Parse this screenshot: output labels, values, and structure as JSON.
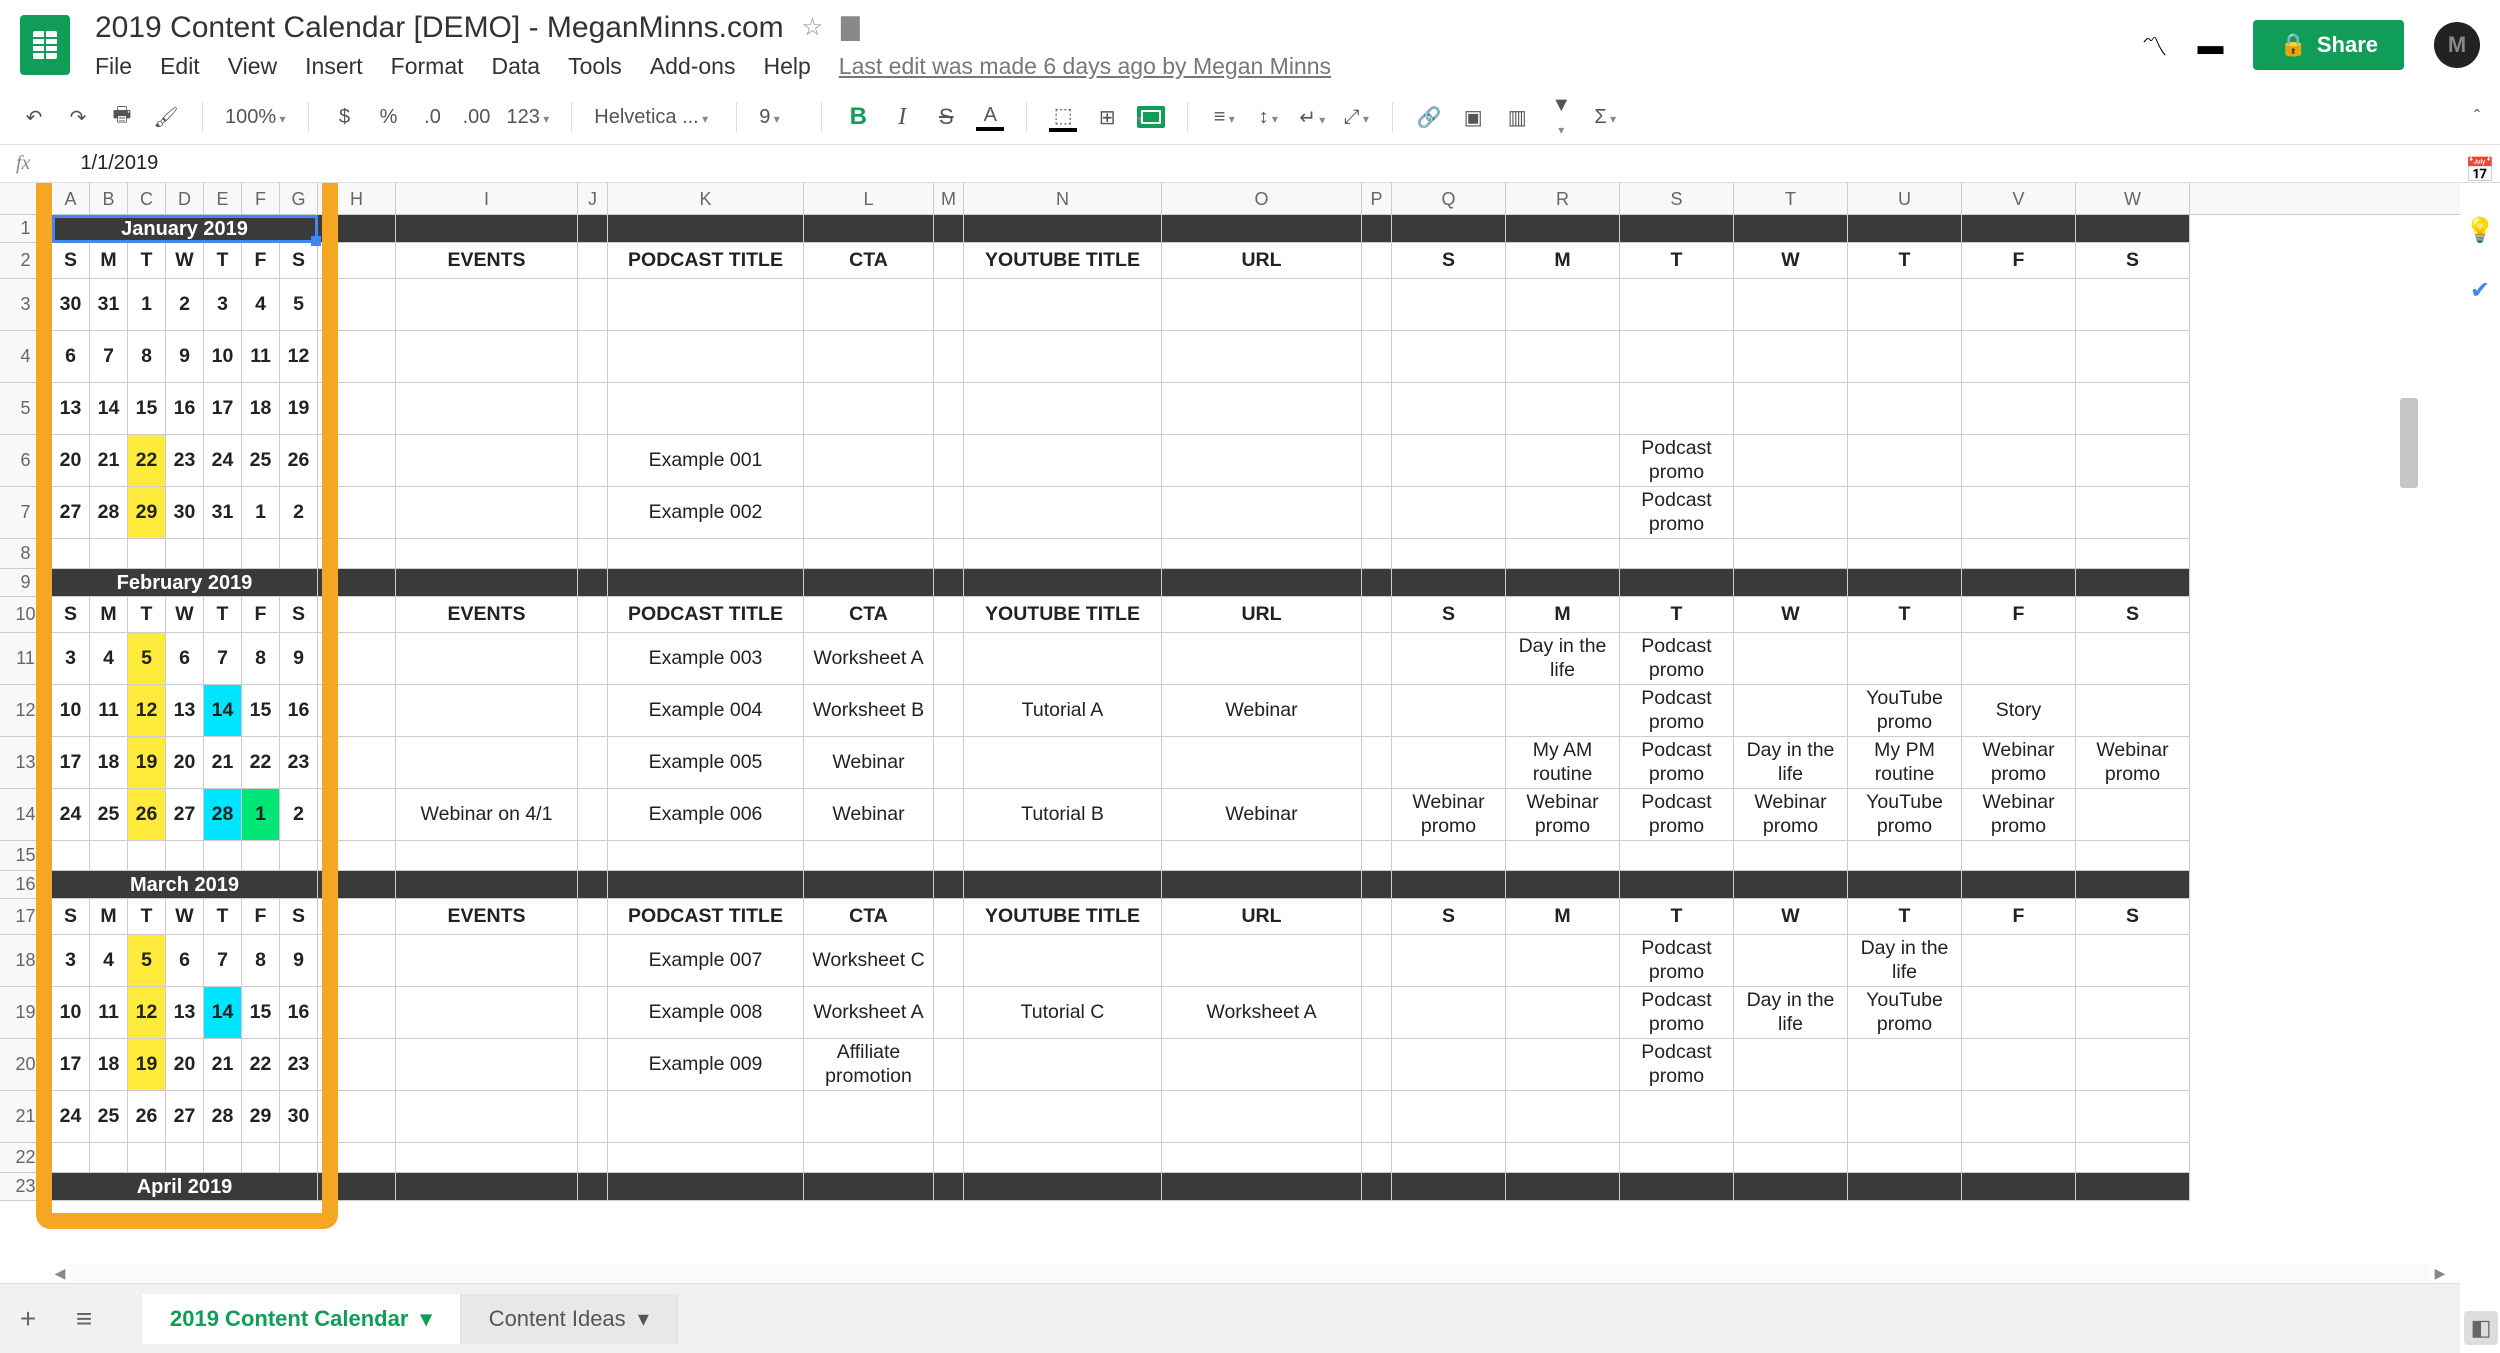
{
  "doc": {
    "title": "2019 Content Calendar [DEMO] - MeganMinns.com"
  },
  "menu": {
    "file": "File",
    "edit": "Edit",
    "view": "View",
    "insert": "Insert",
    "format": "Format",
    "data": "Data",
    "tools": "Tools",
    "addons": "Add-ons",
    "help": "Help",
    "lastEdit": "Last edit was made 6 days ago by Megan Minns"
  },
  "toolbar": {
    "zoom": "100%",
    "font": "Helvetica ...",
    "size": "9",
    "decimals": ".0",
    "decimals2": ".00",
    "format123": "123"
  },
  "share": "Share",
  "avatar": "M",
  "fx": {
    "value": "1/1/2019"
  },
  "tabs": {
    "active": "2019 Content Calendar",
    "second": "Content Ideas"
  },
  "columns": [
    "A",
    "B",
    "C",
    "D",
    "E",
    "F",
    "G",
    "H",
    "I",
    "J",
    "K",
    "L",
    "M",
    "N",
    "O",
    "P",
    "Q",
    "R",
    "S",
    "T",
    "U",
    "V",
    "W"
  ],
  "colWidths": {
    "cal": 38,
    "H": 78,
    "I": 182,
    "J": 30,
    "K": 196,
    "L": 130,
    "M": 30,
    "N": 198,
    "O": 200,
    "P": 30,
    "QW": 114
  },
  "rowNums": [
    1,
    2,
    3,
    4,
    5,
    6,
    7,
    8,
    9,
    10,
    11,
    12,
    13,
    14,
    15,
    16,
    17,
    18,
    19,
    20,
    21,
    22,
    23
  ],
  "months": {
    "jan": "January 2019",
    "feb": "February 2019",
    "mar": "March 2019",
    "apr": "April 2019"
  },
  "dayHdr": [
    "S",
    "M",
    "T",
    "W",
    "T",
    "F",
    "S"
  ],
  "contentHdr": {
    "events": "EVENTS",
    "podcast": "PODCAST TITLE",
    "cta": "CTA",
    "youtube": "YOUTUBE TITLE",
    "url": "URL",
    "s": "S",
    "m": "M",
    "t": "T",
    "w": "W",
    "t2": "T",
    "f": "F",
    "s2": "S"
  },
  "jan": {
    "weeks": [
      [
        "30",
        "31",
        "1",
        "2",
        "3",
        "4",
        "5"
      ],
      [
        "6",
        "7",
        "8",
        "9",
        "10",
        "11",
        "12"
      ],
      [
        "13",
        "14",
        "15",
        "16",
        "17",
        "18",
        "19"
      ],
      [
        "20",
        "21",
        "22",
        "23",
        "24",
        "25",
        "26"
      ],
      [
        "27",
        "28",
        "29",
        "30",
        "31",
        "1",
        "2"
      ]
    ],
    "rows": [
      {},
      {},
      {},
      {
        "podcast": "Example 001",
        "t": "Podcast promo"
      },
      {
        "podcast": "Example 002",
        "t": "Podcast promo"
      }
    ],
    "hl": {
      "3": {
        "2": "yellow"
      },
      "4": {
        "2": "yellow"
      }
    }
  },
  "feb": {
    "weeks": [
      [
        "3",
        "4",
        "5",
        "6",
        "7",
        "8",
        "9"
      ],
      [
        "10",
        "11",
        "12",
        "13",
        "14",
        "15",
        "16"
      ],
      [
        "17",
        "18",
        "19",
        "20",
        "21",
        "22",
        "23"
      ],
      [
        "24",
        "25",
        "26",
        "27",
        "28",
        "1",
        "2"
      ]
    ],
    "rows": [
      {
        "podcast": "Example 003",
        "cta": "Worksheet A",
        "m": "Day in the life",
        "t": "Podcast promo"
      },
      {
        "podcast": "Example 004",
        "cta": "Worksheet B",
        "youtube": "Tutorial A",
        "url": "Webinar",
        "t": "Podcast promo",
        "t2": "YouTube promo",
        "f": "Story"
      },
      {
        "podcast": "Example 005",
        "cta": "Webinar",
        "m": "My AM routine",
        "t": "Podcast promo",
        "w": "Day in the life",
        "t2": "My PM routine",
        "f": "Webinar promo",
        "s2": "Webinar promo"
      },
      {
        "events": "Webinar on 4/1",
        "podcast": "Example 006",
        "cta": "Webinar",
        "youtube": "Tutorial B",
        "url": "Webinar",
        "s": "Webinar promo",
        "m": "Webinar promo",
        "t": "Podcast promo",
        "w": "Webinar promo",
        "t2": "YouTube promo",
        "f": "Webinar promo"
      }
    ],
    "hl": {
      "0": {
        "2": "yellow"
      },
      "1": {
        "2": "yellow",
        "4": "cyan"
      },
      "2": {
        "2": "yellow"
      },
      "3": {
        "2": "yellow",
        "4": "cyan",
        "5": "green"
      }
    }
  },
  "mar": {
    "weeks": [
      [
        "3",
        "4",
        "5",
        "6",
        "7",
        "8",
        "9"
      ],
      [
        "10",
        "11",
        "12",
        "13",
        "14",
        "15",
        "16"
      ],
      [
        "17",
        "18",
        "19",
        "20",
        "21",
        "22",
        "23"
      ],
      [
        "24",
        "25",
        "26",
        "27",
        "28",
        "29",
        "30"
      ]
    ],
    "rows": [
      {
        "podcast": "Example 007",
        "cta": "Worksheet C",
        "t": "Podcast promo",
        "t2": "Day in the life"
      },
      {
        "podcast": "Example 008",
        "cta": "Worksheet A",
        "youtube": "Tutorial C",
        "url": "Worksheet A",
        "t": "Podcast promo",
        "w": "Day in the life",
        "t2": "YouTube promo"
      },
      {
        "podcast": "Example 009",
        "cta": "Affiliate promotion",
        "t": "Podcast promo"
      },
      {}
    ],
    "hl": {
      "0": {
        "2": "yellow"
      },
      "1": {
        "2": "yellow",
        "4": "cyan"
      },
      "2": {
        "2": "yellow"
      }
    }
  }
}
